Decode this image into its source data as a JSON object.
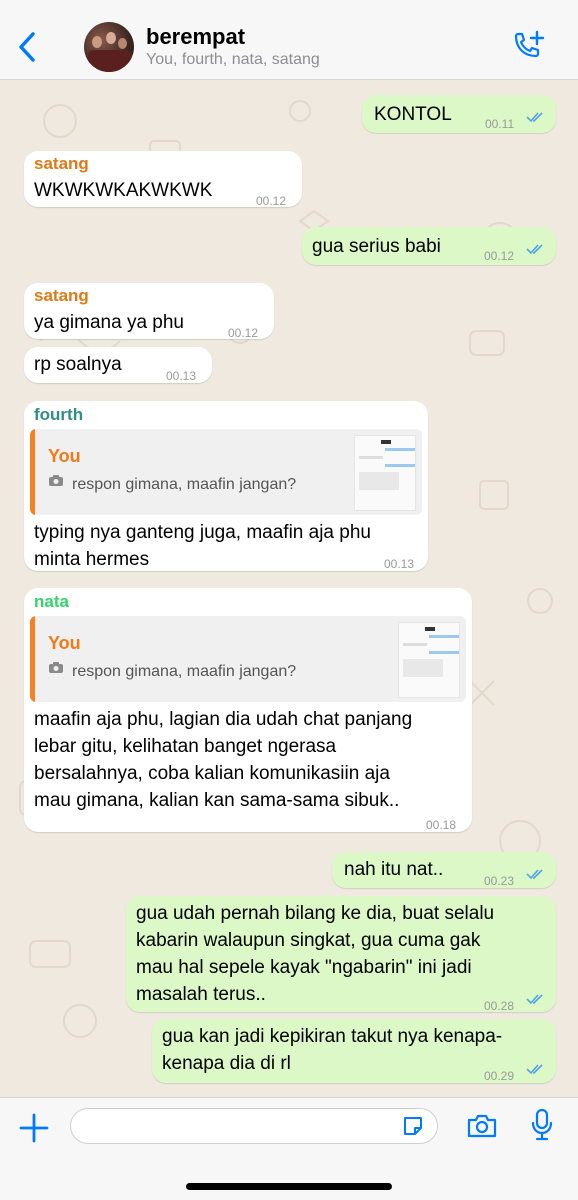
{
  "header": {
    "title": "berempat",
    "subtitle": "You, fourth, nata, satang",
    "back_icon": "chevron-left-icon",
    "call_icon": "add-call-icon",
    "accent_color": "#007aff"
  },
  "messages": [
    {
      "id": "m1",
      "direction": "outgoing",
      "text": "KONTOL",
      "time": "00.11",
      "status": "read"
    },
    {
      "id": "m2",
      "direction": "incoming",
      "sender": "satang",
      "sender_color": "#e07a16",
      "text": "WKWKWKAKWKWK",
      "time": "00.12"
    },
    {
      "id": "m3",
      "direction": "outgoing",
      "text": "gua serius babi",
      "time": "00.12",
      "status": "read"
    },
    {
      "id": "m4",
      "direction": "incoming",
      "sender": "satang",
      "sender_color": "#e07a16",
      "text": "ya gimana ya phu",
      "time": "00.12"
    },
    {
      "id": "m5",
      "direction": "incoming",
      "text": "rp soalnya",
      "time": "00.13"
    },
    {
      "id": "m6",
      "direction": "incoming",
      "sender": "fourth",
      "sender_color": "#2f8f87",
      "quote": {
        "name": "You",
        "text": "respon gimana, maafin jangan?"
      },
      "lines": [
        "typing nya ganteng juga, maafin aja phu",
        "minta hermes"
      ],
      "time": "00.13"
    },
    {
      "id": "m7",
      "direction": "incoming",
      "sender": "nata",
      "sender_color": "#2fd66b",
      "quote": {
        "name": "You",
        "text": "respon gimana, maafin jangan?"
      },
      "lines": [
        "maafin aja phu, lagian dia udah chat panjang",
        "lebar gitu, kelihatan banget ngerasa",
        "bersalahnya, coba kalian komunikasiin aja",
        "mau gimana, kalian kan sama-sama sibuk.."
      ],
      "time": "00.18"
    },
    {
      "id": "m8",
      "direction": "outgoing",
      "text": "nah itu nat..",
      "time": "00.23",
      "status": "read"
    },
    {
      "id": "m9",
      "direction": "outgoing",
      "lines": [
        "gua udah pernah bilang ke dia, buat selalu",
        "kabarin walaupun singkat, gua cuma gak",
        "mau hal sepele kayak \"ngabarin\" ini jadi",
        "masalah terus.."
      ],
      "time": "00.28",
      "status": "read"
    },
    {
      "id": "m10",
      "direction": "outgoing",
      "lines": [
        "gua kan jadi kepikiran takut nya kenapa-",
        "kenapa dia di rl"
      ],
      "time": "00.29",
      "status": "read"
    }
  ],
  "composer": {
    "value": "",
    "plus_icon": "plus-icon",
    "sticker_icon": "sticker-icon",
    "camera_icon": "camera-icon",
    "mic_icon": "microphone-icon"
  }
}
